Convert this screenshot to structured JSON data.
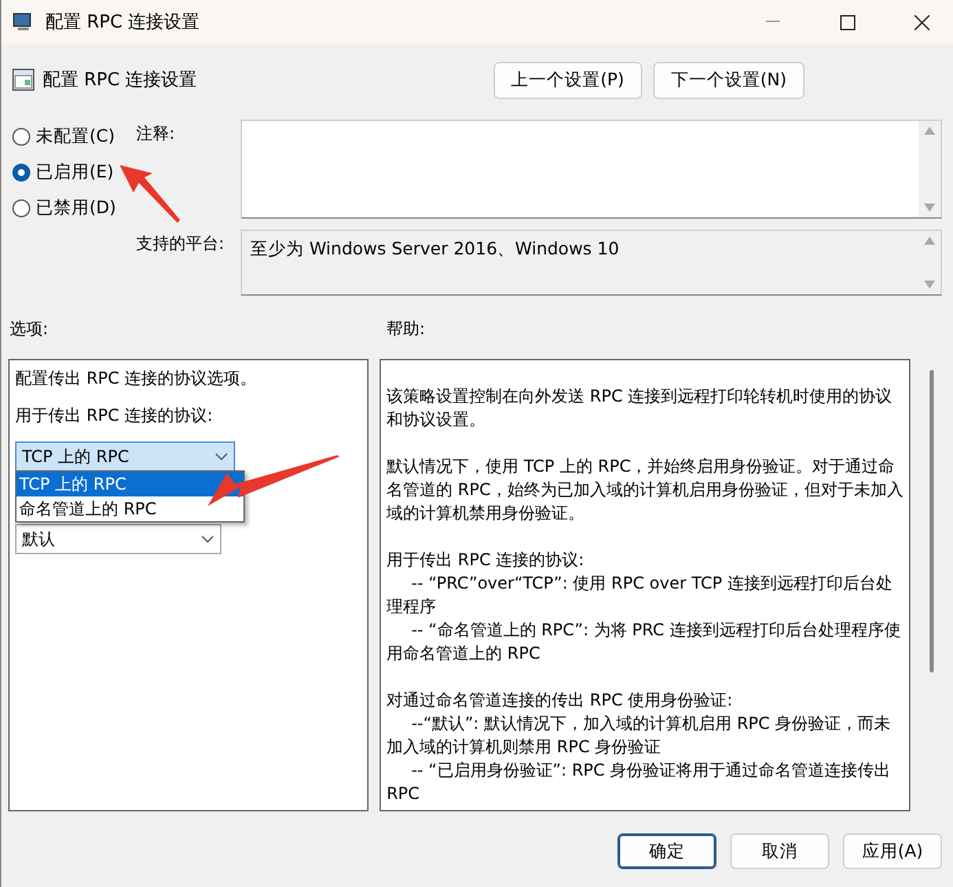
{
  "window": {
    "title": "配置 RPC 连接设置"
  },
  "header": {
    "title": "配置 RPC 连接设置",
    "buttons": [
      "上一个设置(P)",
      "下一个设置(N)"
    ]
  },
  "state_options": [
    {
      "label": "未配置(C)",
      "selected": false
    },
    {
      "label": "已启用(E)",
      "selected": true
    },
    {
      "label": "已禁用(D)",
      "selected": false
    }
  ],
  "comment": {
    "label": "注释:"
  },
  "platform": {
    "label": "支持的平台:",
    "value": "至少为 Windows Server 2016、Windows 10"
  },
  "options": {
    "label": "选项:",
    "description": "配置传出 RPC 连接的协议选项。",
    "protocol_label": "用于传出 RPC 连接的协议:",
    "protocol_value": "TCP 上的 RPC",
    "protocol_list": [
      {
        "label": "TCP 上的 RPC",
        "selected": true
      },
      {
        "label": "命名管道上的 RPC",
        "selected": false
      }
    ],
    "auth_value": "默认"
  },
  "help": {
    "label": "帮助:",
    "blocks": [
      {
        "kind": "para",
        "text": "该策略设置控制在向外发送 RPC 连接到远程打印轮转机时使用的协议和协议设置。"
      },
      {
        "kind": "para",
        "text": "默认情况下，使用 TCP 上的 RPC，并始终启用身份验证。对于通过命名管道的 RPC，始终为已加入域的计算机启用身份验证，但对于未加入域的计算机禁用身份验证。"
      },
      {
        "kind": "para",
        "text": "用于传出 RPC 连接的协议:"
      },
      {
        "kind": "item",
        "text": "-- “PRC”over“TCP”: 使用 RPC over TCP 连接到远程打印后台处理程序"
      },
      {
        "kind": "item",
        "text": "-- “命名管道上的 RPC”: 为将 PRC 连接到远程打印后台处理程序使用命名管道上的 RPC"
      },
      {
        "kind": "para",
        "text": "对通过命名管道连接的传出 RPC 使用身份验证:"
      },
      {
        "kind": "item",
        "text": "--“默认”: 默认情况下，加入域的计算机启用 RPC 身份验证，而未加入域的计算机则禁用 RPC 身份验证"
      },
      {
        "kind": "item",
        "text": "-- “已启用身份验证”: RPC 身份验证将用于通过命名管道连接传出 RPC"
      }
    ]
  },
  "footer": {
    "buttons": [
      {
        "label": "确定",
        "selected": true
      },
      {
        "label": "取消",
        "selected": false
      },
      {
        "label": "应用(A)",
        "selected": false
      }
    ]
  }
}
